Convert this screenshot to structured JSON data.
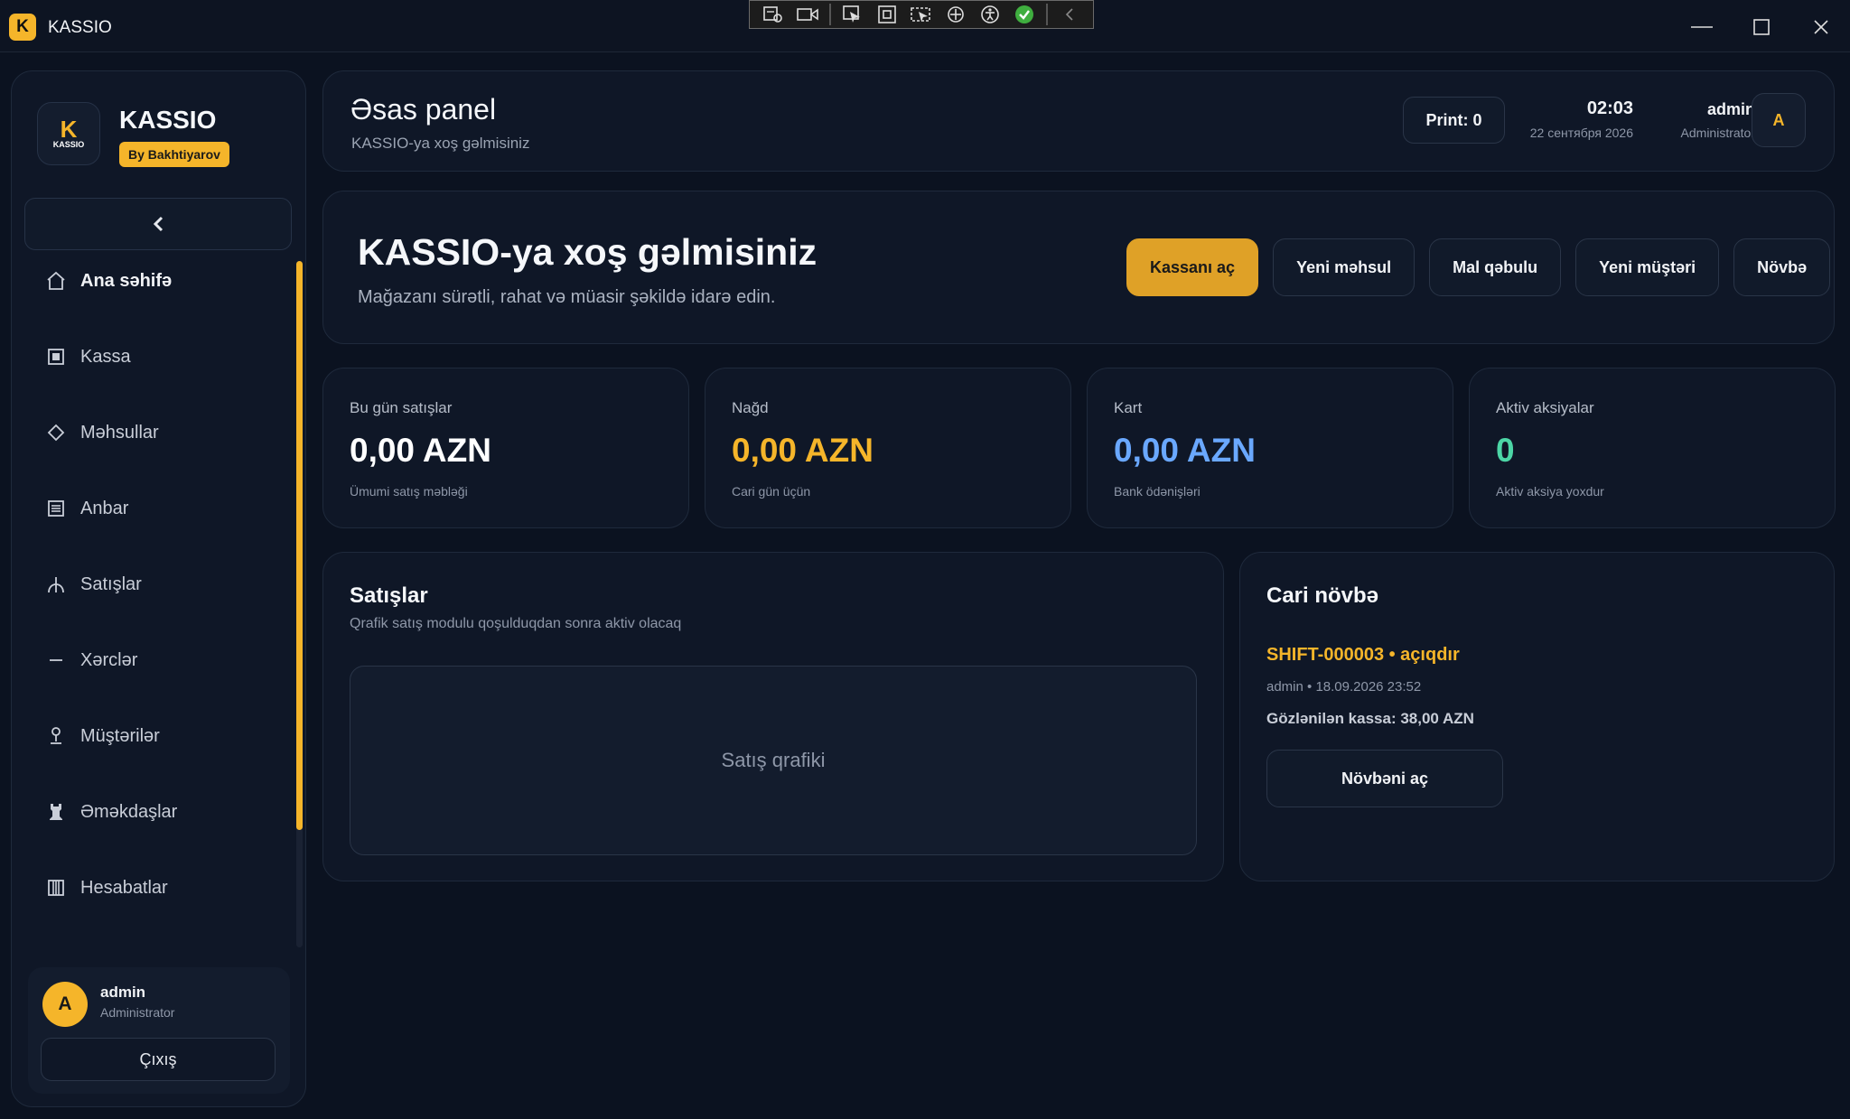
{
  "window": {
    "app_badge": "K",
    "title": "KASSIO"
  },
  "sidebar": {
    "logo_mark": "K",
    "logo_text": "KASSIO",
    "brand_name": "KASSIO",
    "brand_tag": "By Bakhtiyarov",
    "collapse_icon": "chevron-left-icon",
    "items": [
      {
        "label": "Ana səhifə",
        "icon": "home-icon"
      },
      {
        "label": "Kassa",
        "icon": "register-icon"
      },
      {
        "label": "Məhsullar",
        "icon": "diamond-icon"
      },
      {
        "label": "Anbar",
        "icon": "warehouse-icon"
      },
      {
        "label": "Satışlar",
        "icon": "sales-icon"
      },
      {
        "label": "Xərclər",
        "icon": "minus-icon"
      },
      {
        "label": "Müştərilər",
        "icon": "customer-icon"
      },
      {
        "label": "Əməkdaşlar",
        "icon": "staff-icon"
      },
      {
        "label": "Hesabatlar",
        "icon": "reports-icon"
      }
    ],
    "user": {
      "initial": "A",
      "name": "admin",
      "role": "Administrator",
      "logout_label": "Çıxış"
    }
  },
  "header": {
    "title": "Əsas panel",
    "subtitle": "KASSIO-ya xoş gəlmisiniz",
    "print_label": "Print: 0",
    "time": "02:03",
    "date": "22 сентября 2026",
    "user_name": "admin",
    "user_role": "Administrator",
    "avatar_initial": "A"
  },
  "hero": {
    "title": "KASSIO-ya xoş gəlmisiniz",
    "subtitle": "Mağazanı sürətli, rahat və müasir şəkildə idarə edin.",
    "actions": [
      "Kassanı aç",
      "Yeni məhsul",
      "Mal qəbulu",
      "Yeni müştəri",
      "Növbə"
    ]
  },
  "stats": [
    {
      "label": "Bu gün satışlar",
      "value": "0,00 AZN",
      "note": "Ümumi satış məbləği",
      "color": "#ffffff"
    },
    {
      "label": "Nağd",
      "value": "0,00 AZN",
      "note": "Cari gün üçün",
      "color": "#f5b52a"
    },
    {
      "label": "Kart",
      "value": "0,00 AZN",
      "note": "Bank ödənişləri",
      "color": "#6aa8ff"
    },
    {
      "label": "Aktiv aksiyalar",
      "value": "0",
      "note": "Aktiv aksiya yoxdur",
      "color": "#4cd6a6"
    }
  ],
  "sales": {
    "title": "Satışlar",
    "subtitle": "Qrafik satış modulu qoşulduqdan sonra aktiv olacaq",
    "placeholder": "Satış qrafiki"
  },
  "shift": {
    "title": "Cari növbə",
    "id_status": "SHIFT-000003 • açıqdır",
    "meta": "admin • 18.09.2026 23:52",
    "expected": "Gözlənilən kassa: 38,00 AZN",
    "button": "Növbəni aç"
  },
  "colors": {
    "accent": "#f5b52a",
    "bg": "#0b1220",
    "card": "#0f1727"
  }
}
